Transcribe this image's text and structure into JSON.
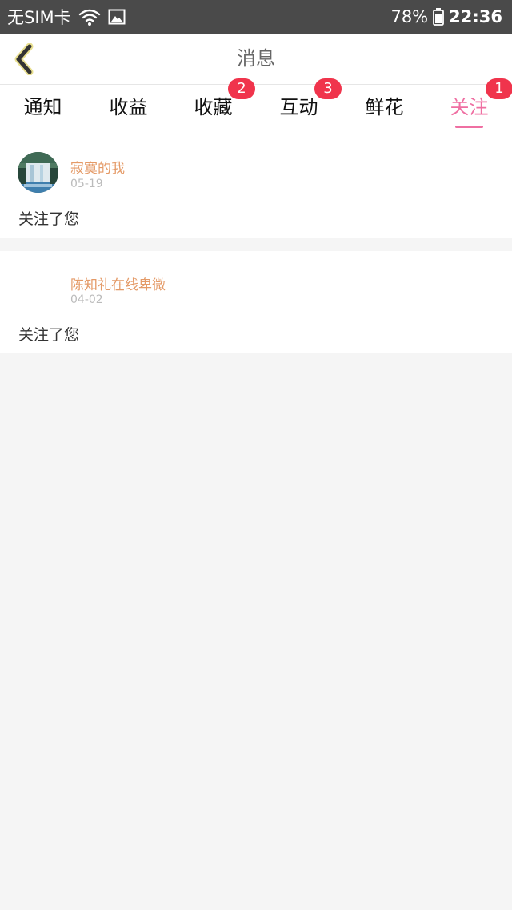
{
  "status_bar": {
    "carrier": "无SIM卡",
    "battery": "78%",
    "time": "22:36",
    "icons": [
      "wifi-icon",
      "image-icon",
      "battery-icon"
    ]
  },
  "nav": {
    "title": "消息",
    "back_icon": "chevron-left-icon"
  },
  "tabs": [
    {
      "label": "通知",
      "badge": "",
      "active": false
    },
    {
      "label": "收益",
      "badge": "",
      "active": false
    },
    {
      "label": "收藏",
      "badge": "2",
      "active": false
    },
    {
      "label": "互动",
      "badge": "3",
      "active": false
    },
    {
      "label": "鲜花",
      "badge": "",
      "active": false
    },
    {
      "label": "关注",
      "badge": "1",
      "active": true
    }
  ],
  "messages": [
    {
      "name": "寂寞的我",
      "date": "05-19",
      "text": "关注了您",
      "avatar": "waterfall-avatar"
    },
    {
      "name": "陈知礼在线卑微",
      "date": "04-02",
      "text": "关注了您",
      "avatar": ""
    }
  ],
  "colors": {
    "accent": "#ef6fa2",
    "badge": "#f0344c",
    "name": "#e49a67",
    "status_bar": "#4a4a4a",
    "background": "#f5f5f5"
  }
}
